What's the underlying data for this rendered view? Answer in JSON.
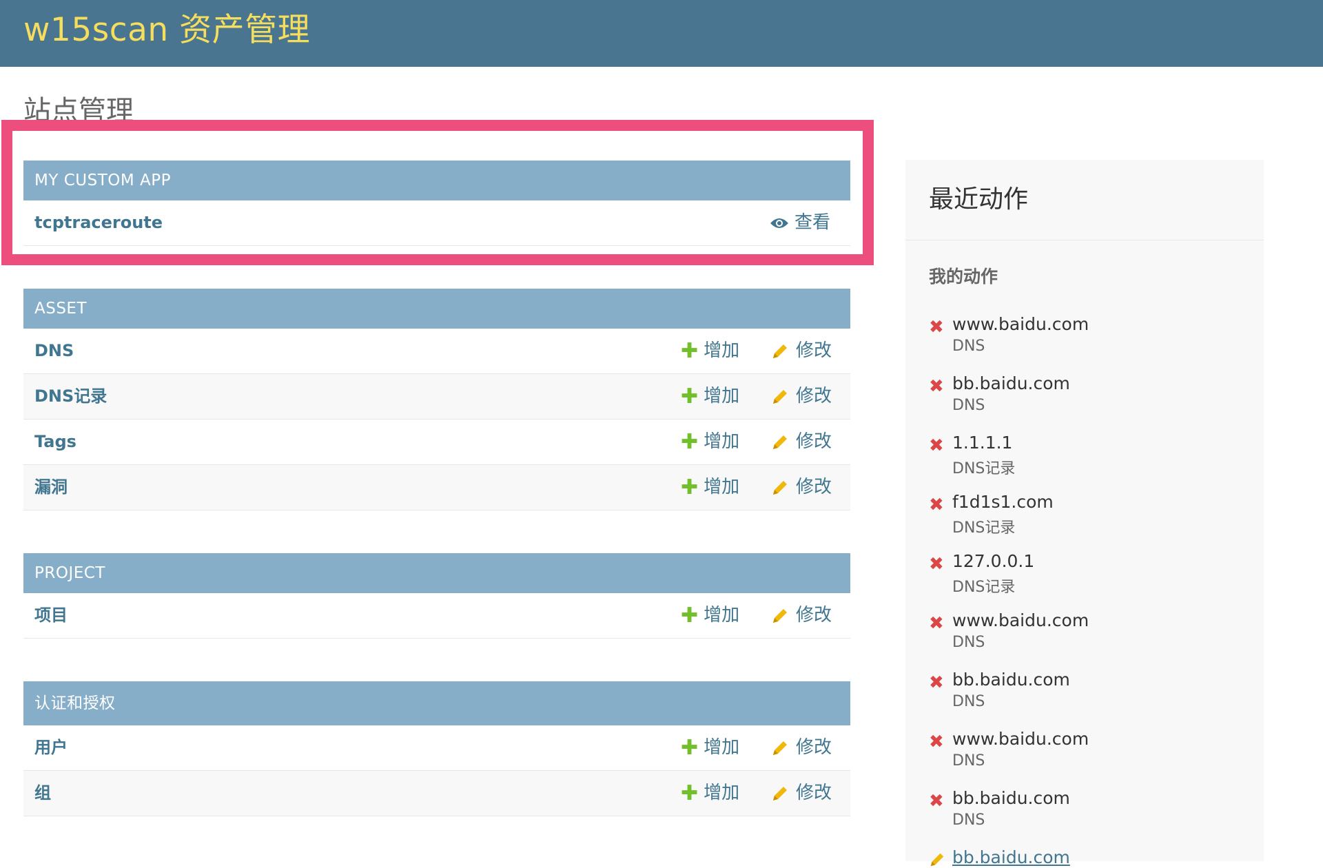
{
  "header": {
    "branding": "w15scan 资产管理"
  },
  "page_title": "站点管理",
  "modules": [
    {
      "caption": "MY CUSTOM APP",
      "models": [
        {
          "name": "tcptraceroute",
          "view_label": "查看"
        }
      ]
    },
    {
      "caption": "ASSET",
      "models": [
        {
          "name": "DNS",
          "add_label": "增加",
          "change_label": "修改"
        },
        {
          "name": "DNS记录",
          "add_label": "增加",
          "change_label": "修改"
        },
        {
          "name": "Tags",
          "add_label": "增加",
          "change_label": "修改"
        },
        {
          "name": "漏洞",
          "add_label": "增加",
          "change_label": "修改"
        }
      ]
    },
    {
      "caption": "PROJECT",
      "models": [
        {
          "name": "项目",
          "add_label": "增加",
          "change_label": "修改"
        }
      ]
    },
    {
      "caption": "认证和授权",
      "models": [
        {
          "name": "用户",
          "add_label": "增加",
          "change_label": "修改"
        },
        {
          "name": "组",
          "add_label": "增加",
          "change_label": "修改"
        }
      ]
    }
  ],
  "recent_actions": {
    "title": "最近动作",
    "my_actions_title": "我的动作",
    "items": [
      {
        "name": "www.baidu.com",
        "type": "DNS",
        "icon": "delete-icon"
      },
      {
        "name": "bb.baidu.com",
        "type": "DNS",
        "icon": "delete-icon"
      },
      {
        "name": "1.1.1.1",
        "type": "DNS记录",
        "icon": "delete-icon"
      },
      {
        "name": "f1d1s1.com",
        "type": "DNS记录",
        "icon": "delete-icon"
      },
      {
        "name": "127.0.0.1",
        "type": "DNS记录",
        "icon": "delete-icon"
      },
      {
        "name": "www.baidu.com",
        "type": "DNS",
        "icon": "delete-icon"
      },
      {
        "name": "bb.baidu.com",
        "type": "DNS",
        "icon": "delete-icon"
      },
      {
        "name": "www.baidu.com",
        "type": "DNS",
        "icon": "delete-icon"
      },
      {
        "name": "bb.baidu.com",
        "type": "DNS",
        "icon": "delete-icon"
      },
      {
        "name": "bb.baidu.com",
        "type": "",
        "icon": "change-icon"
      }
    ]
  },
  "colors": {
    "header_bg": "#4a7590",
    "branding": "#f5dd5d",
    "caption_bg": "#86aec8",
    "link": "#417690",
    "add_icon": "#70bf2b",
    "change_icon": "#efb80b",
    "delete_icon": "#dd4646",
    "highlight_border": "#ec4e7e"
  }
}
